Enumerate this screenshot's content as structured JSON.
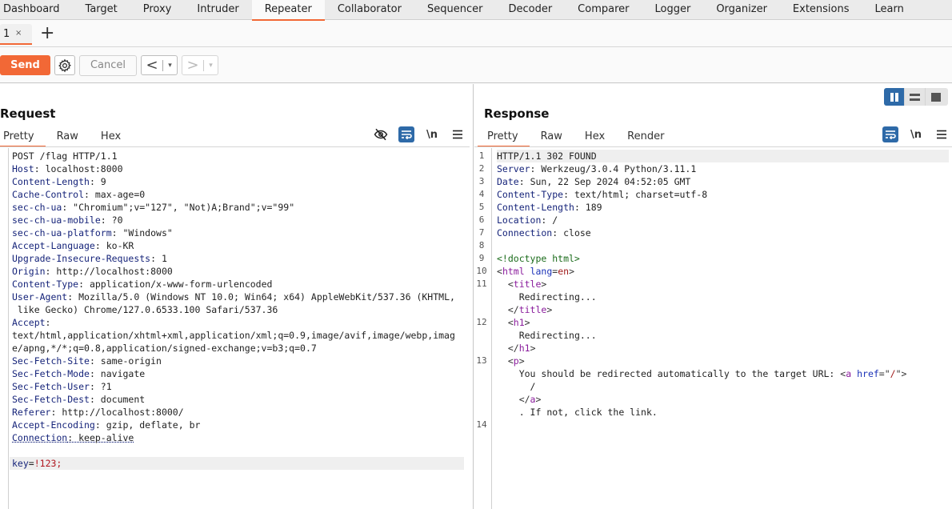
{
  "nav": {
    "tabs": [
      "Dashboard",
      "Target",
      "Proxy",
      "Intruder",
      "Repeater",
      "Collaborator",
      "Sequencer",
      "Decoder",
      "Comparer",
      "Logger",
      "Organizer",
      "Extensions",
      "Learn"
    ],
    "active": "Repeater"
  },
  "repeater_tabs": [
    {
      "label": "1",
      "close": "×"
    }
  ],
  "add_tab_label": "+",
  "toolbar": {
    "send": "Send",
    "cancel": "Cancel",
    "back_arrow": "<",
    "forward_arrow": ">",
    "dropdown": "▾"
  },
  "request": {
    "title": "Request",
    "tabs": [
      "Pretty",
      "Raw",
      "Hex"
    ],
    "active_tab": "Pretty",
    "icons": [
      "hide-eye-icon",
      "wrap-lines-icon",
      "newline-icon",
      "menu-icon"
    ],
    "newline_label": "\\n",
    "request_line": "POST /flag HTTP/1.1",
    "headers": [
      {
        "name": "Host",
        "value": "localhost:8000"
      },
      {
        "name": "Content-Length",
        "value": "9"
      },
      {
        "name": "Cache-Control",
        "value": "max-age=0"
      },
      {
        "name": "sec-ch-ua",
        "value": "\"Chromium\";v=\"127\", \"Not)A;Brand\";v=\"99\""
      },
      {
        "name": "sec-ch-ua-mobile",
        "value": "?0"
      },
      {
        "name": "sec-ch-ua-platform",
        "value": "\"Windows\""
      },
      {
        "name": "Accept-Language",
        "value": "ko-KR"
      },
      {
        "name": "Upgrade-Insecure-Requests",
        "value": "1"
      },
      {
        "name": "Origin",
        "value": "http://localhost:8000"
      },
      {
        "name": "Content-Type",
        "value": "application/x-www-form-urlencoded"
      },
      {
        "name": "User-Agent",
        "value": "Mozilla/5.0 (Windows NT 10.0; Win64; x64) AppleWebKit/537.36 (KHTML,",
        "cont": " like Gecko) Chrome/127.0.6533.100 Safari/537.36"
      },
      {
        "name": "Accept",
        "value": "",
        "cont": "text/html,application/xhtml+xml,application/xml;q=0.9,image/avif,image/webp,imag",
        "cont2": "e/apng,*/*;q=0.8,application/signed-exchange;v=b3;q=0.7"
      },
      {
        "name": "Sec-Fetch-Site",
        "value": "same-origin"
      },
      {
        "name": "Sec-Fetch-Mode",
        "value": "navigate"
      },
      {
        "name": "Sec-Fetch-User",
        "value": "?1"
      },
      {
        "name": "Sec-Fetch-Dest",
        "value": "document"
      },
      {
        "name": "Referer",
        "value": "http://localhost:8000/"
      },
      {
        "name": "Accept-Encoding",
        "value": "gzip, deflate, br"
      },
      {
        "name": "Connection",
        "value": "keep-alive",
        "dotted": true
      }
    ],
    "body": {
      "key": "key",
      "eq": "=",
      "value": "!123;"
    }
  },
  "response": {
    "title": "Response",
    "tabs": [
      "Pretty",
      "Raw",
      "Hex",
      "Render"
    ],
    "active_tab": "Pretty",
    "icons": [
      "wrap-lines-icon",
      "newline-icon",
      "menu-icon"
    ],
    "newline_label": "\\n",
    "layout_toggle": [
      "side-by-side",
      "top-bottom",
      "single"
    ],
    "layout_active": "side-by-side",
    "status_line": "HTTP/1.1 302 FOUND",
    "headers": [
      {
        "name": "Server",
        "value": "Werkzeug/3.0.4 Python/3.11.1"
      },
      {
        "name": "Date",
        "value": "Sun, 22 Sep 2024 04:52:05 GMT"
      },
      {
        "name": "Content-Type",
        "value": "text/html; charset=utf-8"
      },
      {
        "name": "Content-Length",
        "value": "189"
      },
      {
        "name": "Location",
        "value": "/"
      },
      {
        "name": "Connection",
        "value": "close"
      }
    ],
    "body": {
      "doctype": "<!doctype html>",
      "html_open": {
        "tag": "html",
        "attr": "lang",
        "val": "en"
      },
      "title_tag": "title",
      "title_text": "Redirecting...",
      "h1_tag": "h1",
      "h1_text": "Redirecting...",
      "p_tag": "p",
      "p_text": "You should be redirected automatically to the target URL: ",
      "a_tag": "a",
      "a_attr": "href",
      "a_href": "/",
      "a_text": "/",
      "tail_text": ". If not, click the link."
    },
    "line_numbers": [
      "1",
      "2",
      "3",
      "4",
      "5",
      "6",
      "7",
      "8",
      "9",
      "10",
      "11",
      "12",
      "13",
      "14"
    ]
  },
  "colors": {
    "accent": "#f26836",
    "toggle_active": "#2e6aa8",
    "header_name": "#16247a",
    "param_value": "#b0161e",
    "html_tag": "#8a1c9c",
    "doctype": "#1a6b1a"
  }
}
